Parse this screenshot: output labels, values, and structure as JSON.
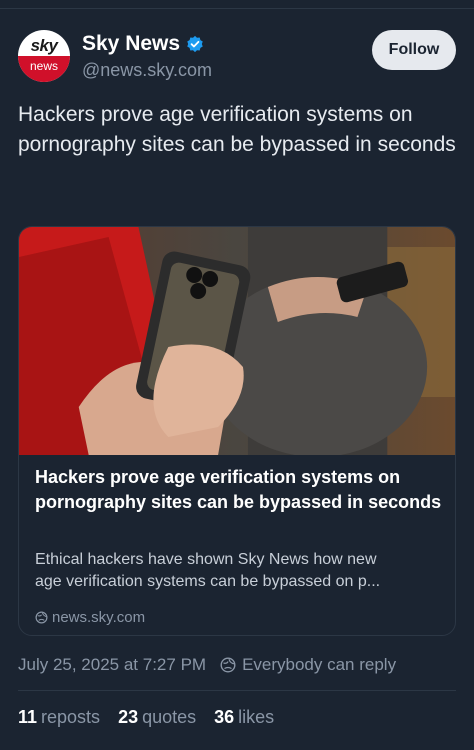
{
  "account": {
    "display_name": "Sky News",
    "handle": "@news.sky.com",
    "avatar_top": "sky",
    "avatar_bottom": "news",
    "follow_label": "Follow"
  },
  "post": {
    "text": "Hackers prove age verification systems on pornography sites can be bypassed in seconds",
    "timestamp": "July 25, 2025 at 7:27 PM",
    "reply_setting": "Everybody can reply"
  },
  "card": {
    "title": "Hackers prove age verification systems on pornography sites can be bypassed in seconds",
    "desc_line1": "Ethical hackers have shown Sky News how new",
    "desc_line2": "age verification systems can be bypassed on p...",
    "source": "news.sky.com"
  },
  "stats": {
    "reposts_count": "11",
    "reposts_label": "reposts",
    "quotes_count": "23",
    "quotes_label": "quotes",
    "likes_count": "36",
    "likes_label": "likes"
  },
  "colors": {
    "background": "#1b2431",
    "verified": "#1d9bf0",
    "sky_red": "#d0102a"
  }
}
